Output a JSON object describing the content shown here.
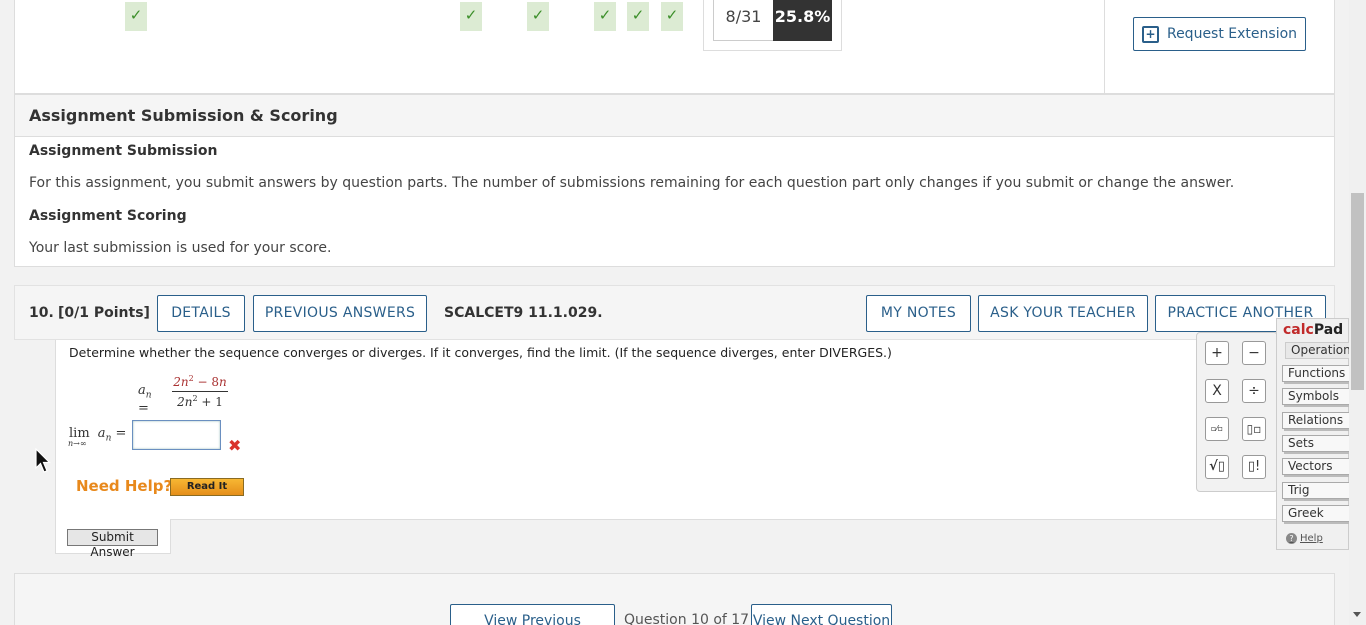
{
  "progress": {
    "checks": [
      "✓",
      "✓",
      "✓",
      "✓",
      "✓",
      "✓"
    ],
    "score_fraction": "8/31",
    "score_percent": "25.8%",
    "request_extension_label": "Request Extension"
  },
  "submission": {
    "title": "Assignment Submission & Scoring",
    "submission_heading": "Assignment Submission",
    "submission_text": "For this assignment, you submit answers by question parts. The number of submissions remaining for each question part only changes if you submit or change the answer.",
    "scoring_heading": "Assignment Scoring",
    "scoring_text": "Your last submission is used for your score."
  },
  "question": {
    "number": "10.",
    "points": "[0/1 Points]",
    "details_label": "DETAILS",
    "previous_answers_label": "PREVIOUS ANSWERS",
    "code": "SCALCET9 11.1.029.",
    "my_notes_label": "MY NOTES",
    "ask_teacher_label": "ASK YOUR TEACHER",
    "practice_another_label": "PRACTICE ANOTHER",
    "prompt": "Determine whether the sequence converges or diverges. If it converges, find the limit. (If the sequence diverges, enter DIVERGES.)",
    "answer_value": "",
    "need_help_label": "Need Help?",
    "read_it_label": "Read It",
    "submit_label": "Submit Answer"
  },
  "calcpad": {
    "title_part1": "calc",
    "title_part2": "Pad",
    "tabs": [
      "Operations",
      "Functions",
      "Symbols",
      "Relations",
      "Sets",
      "Vectors",
      "Trig",
      "Greek"
    ],
    "help_label": "Help",
    "keys": [
      "+",
      "−",
      "X",
      "÷",
      "▫⁄▫",
      "▯▫",
      "√▯",
      "▯!"
    ]
  },
  "footer": {
    "prev_label": "View Previous Question",
    "position_text": "Question 10 of 17",
    "next_label": "View Next Question"
  }
}
